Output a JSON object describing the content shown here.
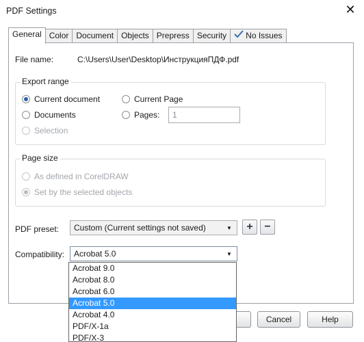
{
  "window": {
    "title": "PDF Settings"
  },
  "tabs": [
    {
      "label": "General"
    },
    {
      "label": "Color"
    },
    {
      "label": "Document"
    },
    {
      "label": "Objects"
    },
    {
      "label": "Prepress"
    },
    {
      "label": "Security"
    },
    {
      "label": "No Issues",
      "icon": "checklist-icon"
    }
  ],
  "active_tab": "General",
  "file": {
    "label": "File name:",
    "value": "C:\\Users\\User\\Desktop\\ИнструкцияПДФ.pdf"
  },
  "export_range": {
    "title": "Export range",
    "current_document": "Current document",
    "documents": "Documents",
    "selection": "Selection",
    "current_page": "Current Page",
    "pages_label": "Pages:",
    "pages_value": "1",
    "selected": "Current document"
  },
  "page_size": {
    "title": "Page size",
    "as_defined": "As defined in CorelDRAW",
    "by_selected": "Set by the selected objects",
    "selected": "Set by the selected objects"
  },
  "pdf_preset": {
    "label": "PDF preset:",
    "value": "Custom (Current settings not saved)",
    "add_glyph": "+",
    "remove_glyph": "−"
  },
  "compatibility": {
    "label": "Compatibility:",
    "value": "Acrobat 5.0",
    "options": [
      "Acrobat 9.0",
      "Acrobat 8.0",
      "Acrobat 6.0",
      "Acrobat 5.0",
      "Acrobat 4.0",
      "PDF/X-1a",
      "PDF/X-3"
    ],
    "selected_option": "Acrobat 5.0"
  },
  "footer": {
    "cancel_label": "Cancel",
    "help_label": "Help"
  },
  "colors": {
    "selection": "#3399ff",
    "radio_fill": "#2a5ea8",
    "border": "#9aa0a6"
  }
}
